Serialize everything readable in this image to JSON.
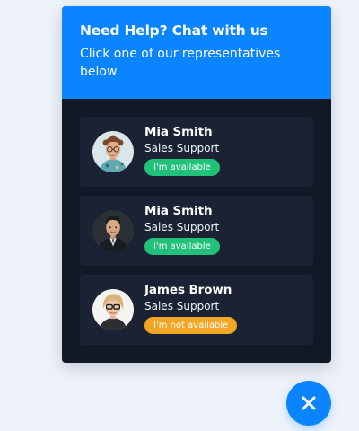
{
  "widget": {
    "title": "Need Help? Chat with us",
    "subtitle": "Click one of our representatives below",
    "colors": {
      "accent": "#0A84FF",
      "panel_bg": "#121826",
      "card_bg": "#1B2233",
      "available": "#22C17A",
      "unavailable": "#F2A623",
      "page_bg": "#EEF2FB"
    }
  },
  "representatives": [
    {
      "name": "Mia Smith",
      "role": "Sales Support",
      "status": "I'm available",
      "available": true,
      "avatar_icon": "avatar-curly-hair-glasses-icon"
    },
    {
      "name": "Mia Smith",
      "role": "Sales Support",
      "status": "I'm available",
      "available": true,
      "avatar_icon": "avatar-man-suit-icon"
    },
    {
      "name": "James Brown",
      "role": "Sales Support",
      "status": "I'm not available",
      "available": false,
      "avatar_icon": "avatar-woman-glasses-icon"
    }
  ],
  "close_button": {
    "icon": "close-icon"
  }
}
